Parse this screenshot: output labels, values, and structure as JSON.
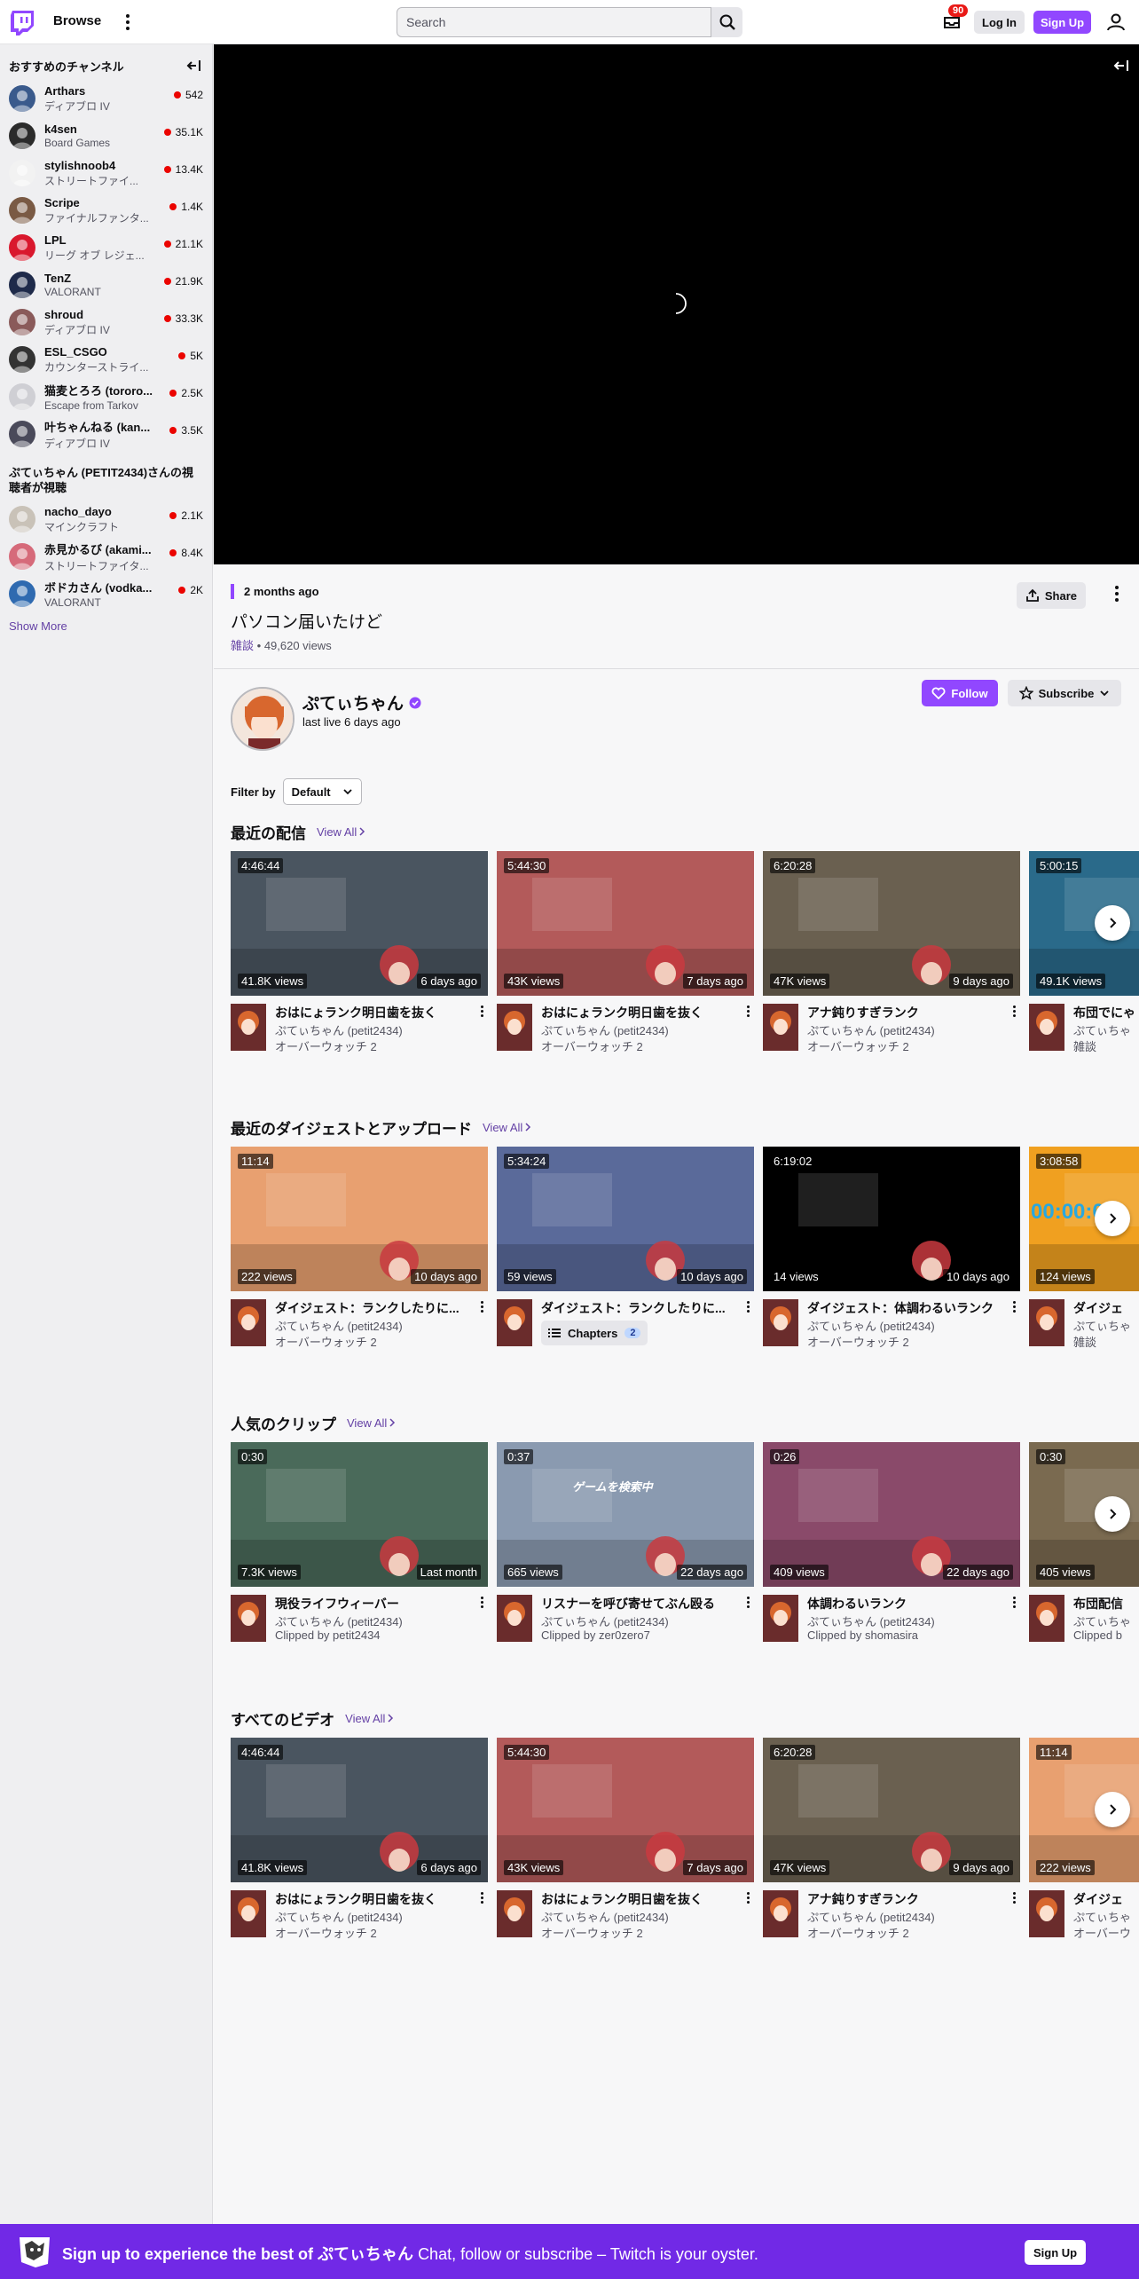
{
  "topnav": {
    "browse_label": "Browse",
    "search_placeholder": "Search",
    "inbox_count": "90",
    "login_label": "Log In",
    "signup_label": "Sign Up",
    "brand_color": "#9147ff"
  },
  "sidebar": {
    "recommended_title": "おすすめのチャンネル",
    "recommended": [
      {
        "name": "Arthars",
        "game": "ディアブロ IV",
        "viewers": "542",
        "color": "#3a5a8c"
      },
      {
        "name": "k4sen",
        "game": "Board Games",
        "viewers": "35.1K",
        "color": "#2b2b2b"
      },
      {
        "name": "stylishnoob4",
        "game": "ストリートファイ...",
        "viewers": "13.4K",
        "color": "#f2f2f2"
      },
      {
        "name": "Scripe",
        "game": "ファイナルファンタ...",
        "viewers": "1.4K",
        "color": "#7a5a44"
      },
      {
        "name": "LPL",
        "game": "リーグ オブ レジェ...",
        "viewers": "21.1K",
        "color": "#d9182d"
      },
      {
        "name": "TenZ",
        "game": "VALORANT",
        "viewers": "21.9K",
        "color": "#1e2a4a"
      },
      {
        "name": "shroud",
        "game": "ディアブロ IV",
        "viewers": "33.3K",
        "color": "#8a5a5a"
      },
      {
        "name": "ESL_CSGO",
        "game": "カウンターストライ...",
        "viewers": "5K",
        "color": "#333333"
      },
      {
        "name": "猫麦とろろ (tororo...",
        "game": "Escape from Tarkov",
        "viewers": "2.5K",
        "color": "#cfcfd4"
      },
      {
        "name": "叶ちゃんねる (kan...",
        "game": "ディアブロ IV",
        "viewers": "3.5K",
        "color": "#4a4a5a"
      }
    ],
    "also_watched_title": "ぷてぃちゃん (PETIT2434)さんの視聴者が視聴",
    "also_watched": [
      {
        "name": "nacho_dayo",
        "game": "マインクラフト",
        "viewers": "2.1K",
        "color": "#c9c2b8"
      },
      {
        "name": "赤見かるび (akami...",
        "game": "ストリートファイタ...",
        "viewers": "8.4K",
        "color": "#d66a7a"
      },
      {
        "name": "ボドカさん (vodka...",
        "game": "VALORANT",
        "viewers": "2K",
        "color": "#2f6ab0"
      }
    ],
    "show_more": "Show More"
  },
  "video": {
    "date": "2 months ago",
    "title": "パソコン届いたけど",
    "category": "雑談",
    "views": "49,620 views",
    "share_label": "Share"
  },
  "channel": {
    "name": "ぷてぃちゃん",
    "last_live": "last live 6 days ago",
    "follow_label": "Follow",
    "subscribe_label": "Subscribe"
  },
  "filter": {
    "label": "Filter by",
    "value": "Default"
  },
  "shelves": [
    {
      "title": "最近の配信",
      "view_all": "View All",
      "cards": [
        {
          "duration": "4:46:44",
          "views": "41.8K views",
          "age": "6 days ago",
          "title": "おはにょランク明日歯を抜く",
          "sub1": "ぷてぃちゃん (petit2434)",
          "sub2": "オーバーウォッチ 2",
          "bg": "#4a5560"
        },
        {
          "duration": "5:44:30",
          "views": "43K views",
          "age": "7 days ago",
          "title": "おはにょランク明日歯を抜く",
          "sub1": "ぷてぃちゃん (petit2434)",
          "sub2": "オーバーウォッチ 2",
          "bg": "#b35a5a"
        },
        {
          "duration": "6:20:28",
          "views": "47K views",
          "age": "9 days ago",
          "title": "アナ鈍りすぎランク",
          "sub1": "ぷてぃちゃん (petit2434)",
          "sub2": "オーバーウォッチ 2",
          "bg": "#6a6050"
        },
        {
          "duration": "5:00:15",
          "views": "49.1K views",
          "age": "",
          "title": "布団でにゃ",
          "sub1": "ぷてぃちゃ",
          "sub2": "雑談",
          "bg": "#2a6a8a"
        }
      ]
    },
    {
      "title": "最近のダイジェストとアップロード",
      "view_all": "View All",
      "cards": [
        {
          "duration": "11:14",
          "views": "222 views",
          "age": "10 days ago",
          "title": "ダイジェスト：ランクしたりに...",
          "sub1": "ぷてぃちゃん (petit2434)",
          "sub2": "オーバーウォッチ 2",
          "bg": "#e8a070"
        },
        {
          "duration": "5:34:24",
          "views": "59 views",
          "age": "10 days ago",
          "title": "ダイジェスト：ランクしたりに...",
          "sub1": "",
          "sub2": "",
          "chapters": "Chapters",
          "chapters_count": "2",
          "bg": "#5a6a9a"
        },
        {
          "duration": "6:19:02",
          "views": "14 views",
          "age": "10 days ago",
          "title": "ダイジェスト：体調わるいランク",
          "sub1": "ぷてぃちゃん (petit2434)",
          "sub2": "オーバーウォッチ 2",
          "bg": "#000000"
        },
        {
          "duration": "3:08:58",
          "views": "124 views",
          "age": "",
          "title": "ダイジェ",
          "sub1": "ぷてぃちゃ",
          "sub2": "雑談",
          "bg": "#f0a020",
          "timer": "00:00:0"
        }
      ]
    },
    {
      "title": "人気のクリップ",
      "view_all": "View All",
      "cards": [
        {
          "duration": "0:30",
          "views": "7.3K views",
          "age": "Last month",
          "title": "現役ライフウィーバー",
          "sub1": "ぷてぃちゃん (petit2434)",
          "sub2": "Clipped by petit2434",
          "bg": "#4a6a5a"
        },
        {
          "duration": "0:37",
          "views": "665 views",
          "age": "22 days ago",
          "title": "リスナーを呼び寄せてぶん殴る",
          "sub1": "ぷてぃちゃん (petit2434)",
          "sub2": "Clipped by zer0zero7",
          "bg": "#8a9ab0",
          "banner": "ゲームを検索中"
        },
        {
          "duration": "0:26",
          "views": "409 views",
          "age": "22 days ago",
          "title": "体調わるいランク",
          "sub1": "ぷてぃちゃん (petit2434)",
          "sub2": "Clipped by shomasira",
          "bg": "#8a4a6a"
        },
        {
          "duration": "0:30",
          "views": "405 views",
          "age": "",
          "title": "布団配信",
          "sub1": "ぷてぃちゃ",
          "sub2": "Clipped b",
          "bg": "#7a6a50"
        }
      ]
    },
    {
      "title": "すべてのビデオ",
      "view_all": "View All",
      "cards": [
        {
          "duration": "4:46:44",
          "views": "41.8K views",
          "age": "6 days ago",
          "title": "おはにょランク明日歯を抜く",
          "sub1": "ぷてぃちゃん (petit2434)",
          "sub2": "オーバーウォッチ 2",
          "bg": "#4a5560"
        },
        {
          "duration": "5:44:30",
          "views": "43K views",
          "age": "7 days ago",
          "title": "おはにょランク明日歯を抜く",
          "sub1": "ぷてぃちゃん (petit2434)",
          "sub2": "オーバーウォッチ 2",
          "bg": "#b35a5a"
        },
        {
          "duration": "6:20:28",
          "views": "47K views",
          "age": "9 days ago",
          "title": "アナ鈍りすぎランク",
          "sub1": "ぷてぃちゃん (petit2434)",
          "sub2": "オーバーウォッチ 2",
          "bg": "#6a6050"
        },
        {
          "duration": "11:14",
          "views": "222 views",
          "age": "",
          "title": "ダイジェ",
          "sub1": "ぷてぃちゃ",
          "sub2": "オーバーウ",
          "bg": "#e8a070"
        }
      ]
    }
  ],
  "banner": {
    "lead": "Sign up to experience the best of ぷてぃちゃん",
    "tagline": "Chat, follow or subscribe – Twitch is your oyster.",
    "signup_label": "Sign Up"
  }
}
